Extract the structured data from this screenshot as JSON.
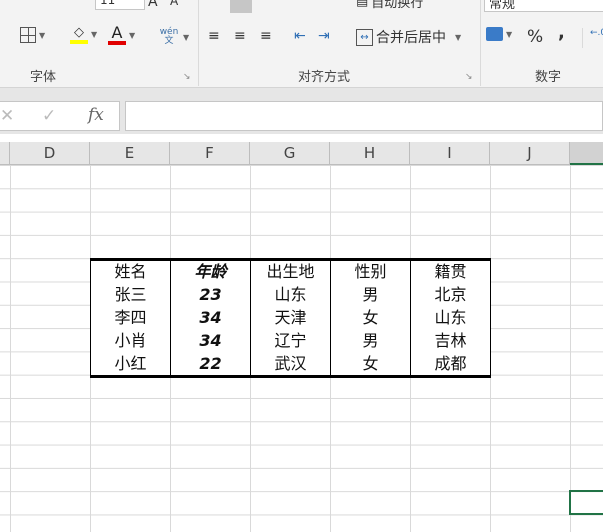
{
  "ribbon": {
    "font_group_label": "字体",
    "alignment_group_label": "对齐方式",
    "number_group_label": "数字",
    "font_size": "11",
    "wrap_text_label": "自动换行",
    "merge_center_label": "合并后居中",
    "number_format": "常规",
    "percent_label": "%",
    "comma_label": ",",
    "phonetic_label": "wén 文",
    "font_color_label": "A",
    "highlight_color": "#ffff00",
    "font_color": "#e00000"
  },
  "formula_bar": {
    "cancel": "✕",
    "enter": "✓",
    "fx": "fx",
    "value": ""
  },
  "columns": [
    "D",
    "E",
    "F",
    "G",
    "H",
    "I",
    "J"
  ],
  "table": {
    "headers": [
      "姓名",
      "年龄",
      "出生地",
      "性别",
      "籍贯"
    ],
    "rows": [
      [
        "张三",
        "23",
        "山东",
        "男",
        "北京"
      ],
      [
        "李四",
        "34",
        "天津",
        "女",
        "山东"
      ],
      [
        "小肖",
        "34",
        "辽宁",
        "男",
        "吉林"
      ],
      [
        "小红",
        "22",
        "武汉",
        "女",
        "成都"
      ]
    ]
  }
}
